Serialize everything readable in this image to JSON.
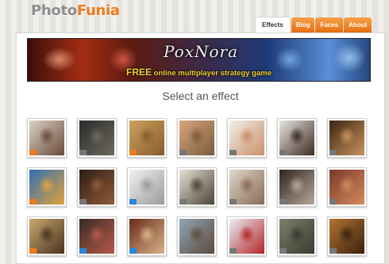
{
  "logo": {
    "part1": "Photo",
    "part2": "Funia"
  },
  "tabs": [
    {
      "label": "Effects",
      "active": true
    },
    {
      "label": "Blog",
      "active": false
    },
    {
      "label": "Faces",
      "active": false
    },
    {
      "label": "About",
      "active": false
    }
  ],
  "banner": {
    "brand": "PoxNora",
    "free": "FREE",
    "tagline": "online multiplayer strategy game"
  },
  "heading": "Select an effect",
  "badge_colors": {
    "orange": "#f07a1c",
    "gray": "#777777",
    "blue": "#2a86d8"
  },
  "thumbnails": [
    {
      "name": "effect-office-frames",
      "colors": [
        "#d9d2c4",
        "#6b4b3a"
      ],
      "badge": "orange"
    },
    {
      "name": "effect-dark-woman",
      "colors": [
        "#2a2a2a",
        "#6d6a5e"
      ],
      "badge": "gray"
    },
    {
      "name": "effect-vintage-stamps",
      "colors": [
        "#caa25c",
        "#8a5b2e"
      ],
      "badge": "orange"
    },
    {
      "name": "effect-gallery-hall",
      "colors": [
        "#d6a57c",
        "#7d5b3d"
      ],
      "badge": "gray"
    },
    {
      "name": "effect-cupid",
      "colors": [
        "#f3efe8",
        "#c98f6a"
      ],
      "badge": "gray"
    },
    {
      "name": "effect-hand-photo",
      "colors": [
        "#e8e6e2",
        "#3d2b22"
      ],
      "badge": "gray"
    },
    {
      "name": "effect-tv-frame",
      "colors": [
        "#3a2514",
        "#c9935c"
      ],
      "badge": "gray"
    },
    {
      "name": "effect-fire-poster",
      "colors": [
        "#2f6fb5",
        "#e2a13c"
      ],
      "badge": "orange"
    },
    {
      "name": "effect-dark-faces",
      "colors": [
        "#2c1d16",
        "#8e5b3a"
      ],
      "badge": "gray"
    },
    {
      "name": "effect-pencil-sketch",
      "colors": [
        "#f1f1f1",
        "#9b9b9b"
      ],
      "badge": "blue"
    },
    {
      "name": "effect-chalkboard-woman",
      "colors": [
        "#e7e1d4",
        "#4d4338"
      ],
      "badge": "gray"
    },
    {
      "name": "effect-exhibition",
      "colors": [
        "#ded7cc",
        "#8b6b54"
      ],
      "badge": "gray"
    },
    {
      "name": "effect-lady-portrait",
      "colors": [
        "#2d2520",
        "#b7a898"
      ],
      "badge": "gray"
    },
    {
      "name": "effect-fence-lock",
      "colors": [
        "#7b3a2a",
        "#d38a5b"
      ],
      "badge": "gray"
    },
    {
      "name": "effect-wanted-poster",
      "colors": [
        "#c9a76e",
        "#4a3420"
      ],
      "badge": "orange"
    },
    {
      "name": "effect-red-carpet",
      "colors": [
        "#3a2a26",
        "#b45b48"
      ],
      "badge": "blue"
    },
    {
      "name": "effect-retro-tv",
      "colors": [
        "#6b2a1a",
        "#d8b48a"
      ],
      "badge": "blue"
    },
    {
      "name": "effect-street-building",
      "colors": [
        "#8fa5b9",
        "#5e4a3a"
      ],
      "badge": "gray"
    },
    {
      "name": "effect-hockey-player",
      "colors": [
        "#e9eef4",
        "#b3262a"
      ],
      "badge": "gray"
    },
    {
      "name": "effect-zombie",
      "colors": [
        "#7a8068",
        "#3a3a32"
      ],
      "badge": "gray"
    },
    {
      "name": "effect-gold-frame",
      "colors": [
        "#b3742d",
        "#3a2210"
      ],
      "badge": "gray"
    }
  ]
}
